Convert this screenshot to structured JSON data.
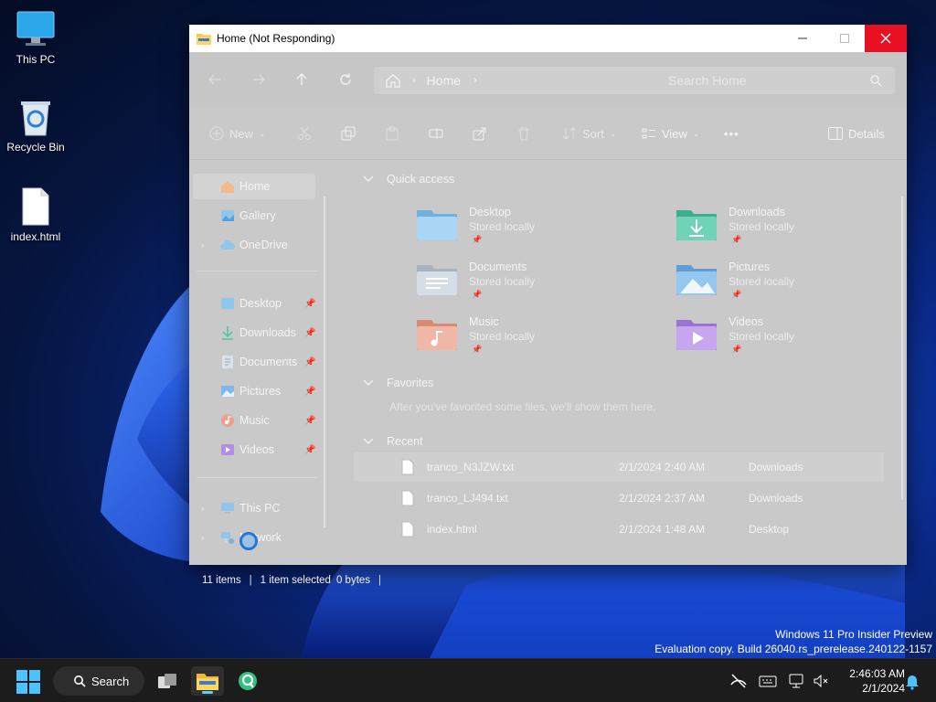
{
  "desktop": {
    "icons": [
      {
        "label": "This PC"
      },
      {
        "label": "Recycle Bin"
      },
      {
        "label": "index.html"
      }
    ],
    "watermark_line1": "Windows 11 Pro Insider Preview",
    "watermark_line2": "Evaluation copy. Build 26040.rs_prerelease.240122-1157"
  },
  "window": {
    "title": "Home (Not Responding)",
    "address": {
      "segment": "Home"
    },
    "search_placeholder": "Search Home",
    "toolbar": {
      "new_label": "New",
      "sort_label": "Sort",
      "view_label": "View",
      "more_label": "•••",
      "details_label": "Details"
    },
    "sidebar": {
      "home": "Home",
      "gallery": "Gallery",
      "onedrive": "OneDrive",
      "pinned": [
        {
          "label": "Desktop"
        },
        {
          "label": "Downloads"
        },
        {
          "label": "Documents"
        },
        {
          "label": "Pictures"
        },
        {
          "label": "Music"
        },
        {
          "label": "Videos"
        }
      ],
      "this_pc": "This PC",
      "network": "Network"
    },
    "quick_access": {
      "heading": "Quick access",
      "items": [
        {
          "name": "Desktop",
          "sub": "Stored locally",
          "color": "#8fc6ec"
        },
        {
          "name": "Downloads",
          "sub": "Stored locally",
          "color": "#58c4a8"
        },
        {
          "name": "Documents",
          "sub": "Stored locally",
          "color": "#b9c7d6"
        },
        {
          "name": "Pictures",
          "sub": "Stored locally",
          "color": "#7fb8e8"
        },
        {
          "name": "Music",
          "sub": "Stored locally",
          "color": "#e8a38f"
        },
        {
          "name": "Videos",
          "sub": "Stored locally",
          "color": "#b48ee0"
        }
      ]
    },
    "favorites": {
      "heading": "Favorites",
      "empty_text": "After you've favorited some files, we'll show them here."
    },
    "recent": {
      "heading": "Recent",
      "rows": [
        {
          "name": "tranco_N3JZW.txt",
          "date": "2/1/2024 2:40 AM",
          "location": "Downloads"
        },
        {
          "name": "tranco_LJ494.txt",
          "date": "2/1/2024 2:37 AM",
          "location": "Downloads"
        },
        {
          "name": "index.html",
          "date": "2/1/2024 1:48 AM",
          "location": "Desktop"
        }
      ]
    },
    "status": {
      "items": "11 items",
      "selected": "1 item selected",
      "size": "0 bytes"
    }
  },
  "taskbar": {
    "search_label": "Search",
    "time": "2:46:03 AM",
    "date": "2/1/2024",
    "accent": "#60cdff"
  }
}
